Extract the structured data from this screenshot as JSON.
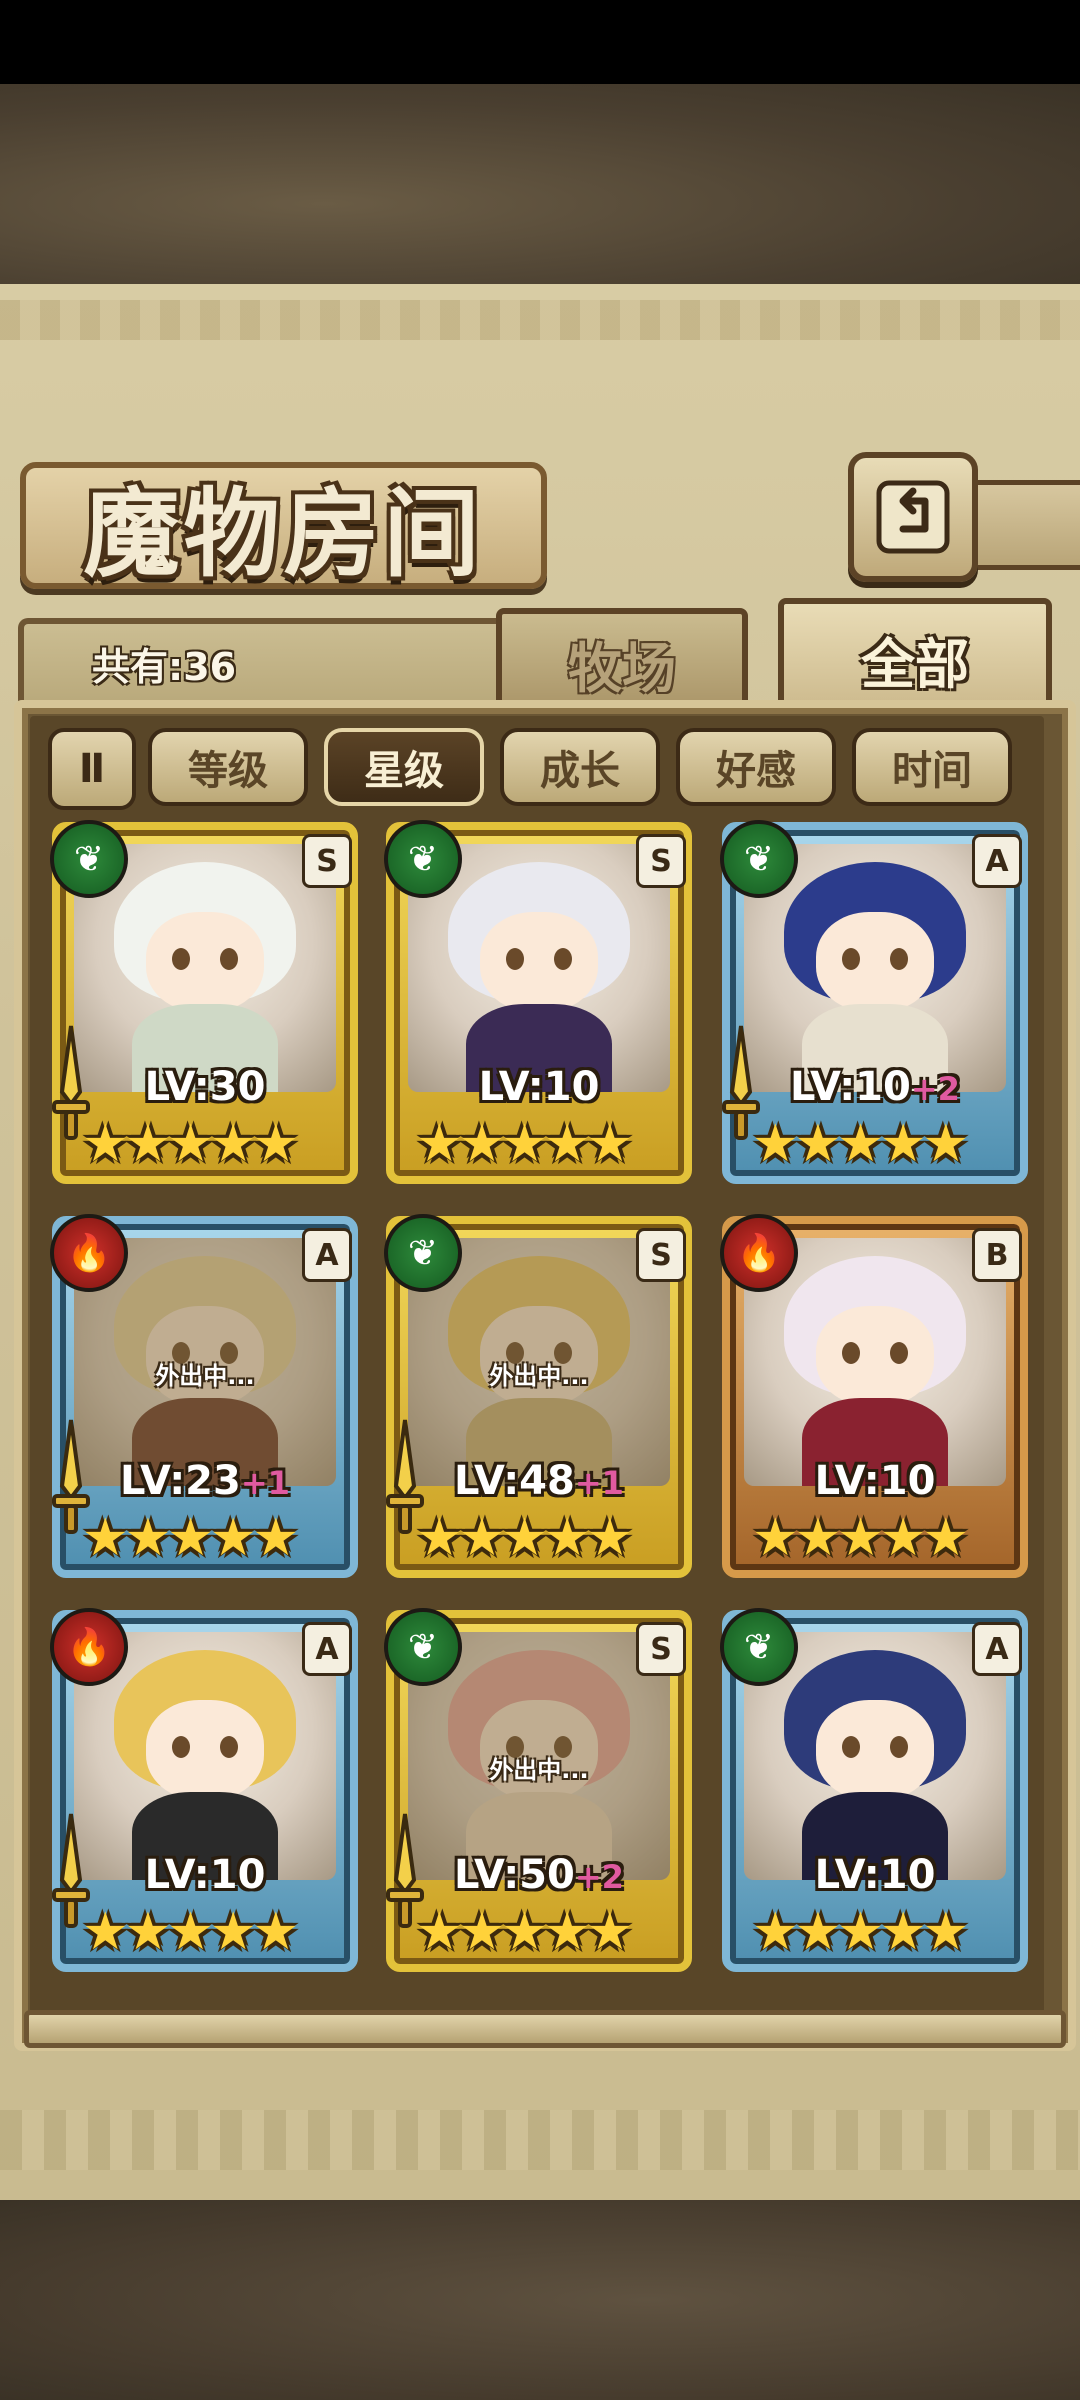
{
  "header": {
    "title": "魔物房间",
    "back_icon": "back-arrow-icon"
  },
  "count": {
    "label": "共有:36"
  },
  "tabs": [
    {
      "label": "牧场",
      "active": false
    },
    {
      "label": "全部",
      "active": true
    }
  ],
  "sort": {
    "toggle_label": "Ⅱ",
    "options": [
      {
        "label": "等级",
        "active": false
      },
      {
        "label": "星级",
        "active": true
      },
      {
        "label": "成长",
        "active": false
      },
      {
        "label": "好感",
        "active": false
      },
      {
        "label": "时间",
        "active": false
      }
    ]
  },
  "monsters": [
    {
      "level_text": "LV:30",
      "plus": "",
      "rank": "S",
      "element": "leaf",
      "frame": "gold",
      "stars": "★★★★★",
      "away": "",
      "weapon": true,
      "hair": "#f1f3ee",
      "outfit": "#cfd9c6"
    },
    {
      "level_text": "LV:10",
      "plus": "",
      "rank": "S",
      "element": "leaf",
      "frame": "gold",
      "stars": "★★★★★",
      "away": "",
      "weapon": false,
      "hair": "#e9e9ef",
      "outfit": "#3b2b55"
    },
    {
      "level_text": "LV:10",
      "plus": "+2",
      "rank": "A",
      "element": "leaf",
      "frame": "blue",
      "stars": "★★★★★",
      "away": "",
      "weapon": true,
      "hair": "#2c3c8c",
      "outfit": "#e7e0cf"
    },
    {
      "level_text": "LV:23",
      "plus": "+1",
      "rank": "A",
      "element": "fire",
      "frame": "blue",
      "stars": "★★★★★",
      "away": "外出中...",
      "weapon": true,
      "hair": "#e6d3a0",
      "outfit": "#6a3a2a"
    },
    {
      "level_text": "LV:48",
      "plus": "+1",
      "rank": "S",
      "element": "leaf",
      "frame": "gold",
      "stars": "★★★★★",
      "away": "外出中...",
      "weapon": true,
      "hair": "#e8c76a",
      "outfit": "#c8b27a"
    },
    {
      "level_text": "LV:10",
      "plus": "",
      "rank": "B",
      "element": "fire",
      "frame": "bronze",
      "stars": "★★★★★",
      "away": "",
      "weapon": false,
      "hair": "#f0e6ee",
      "outfit": "#8a2230"
    },
    {
      "level_text": "LV:10",
      "plus": "",
      "rank": "A",
      "element": "fire",
      "frame": "blue",
      "stars": "★★★★★",
      "away": "",
      "weapon": true,
      "hair": "#e8c45a",
      "outfit": "#2a2a2a"
    },
    {
      "level_text": "LV:50",
      "plus": "+2",
      "rank": "S",
      "element": "leaf",
      "frame": "gold",
      "stars": "★★★★★",
      "away": "外出中...",
      "weapon": true,
      "hair": "#e7a7a0",
      "outfit": "#e9d8c0"
    },
    {
      "level_text": "LV:10",
      "plus": "",
      "rank": "A",
      "element": "leaf",
      "frame": "blue",
      "stars": "★★★★★",
      "away": "",
      "weapon": false,
      "hair": "#2d3b7a",
      "outfit": "#1e1e3a"
    }
  ]
}
